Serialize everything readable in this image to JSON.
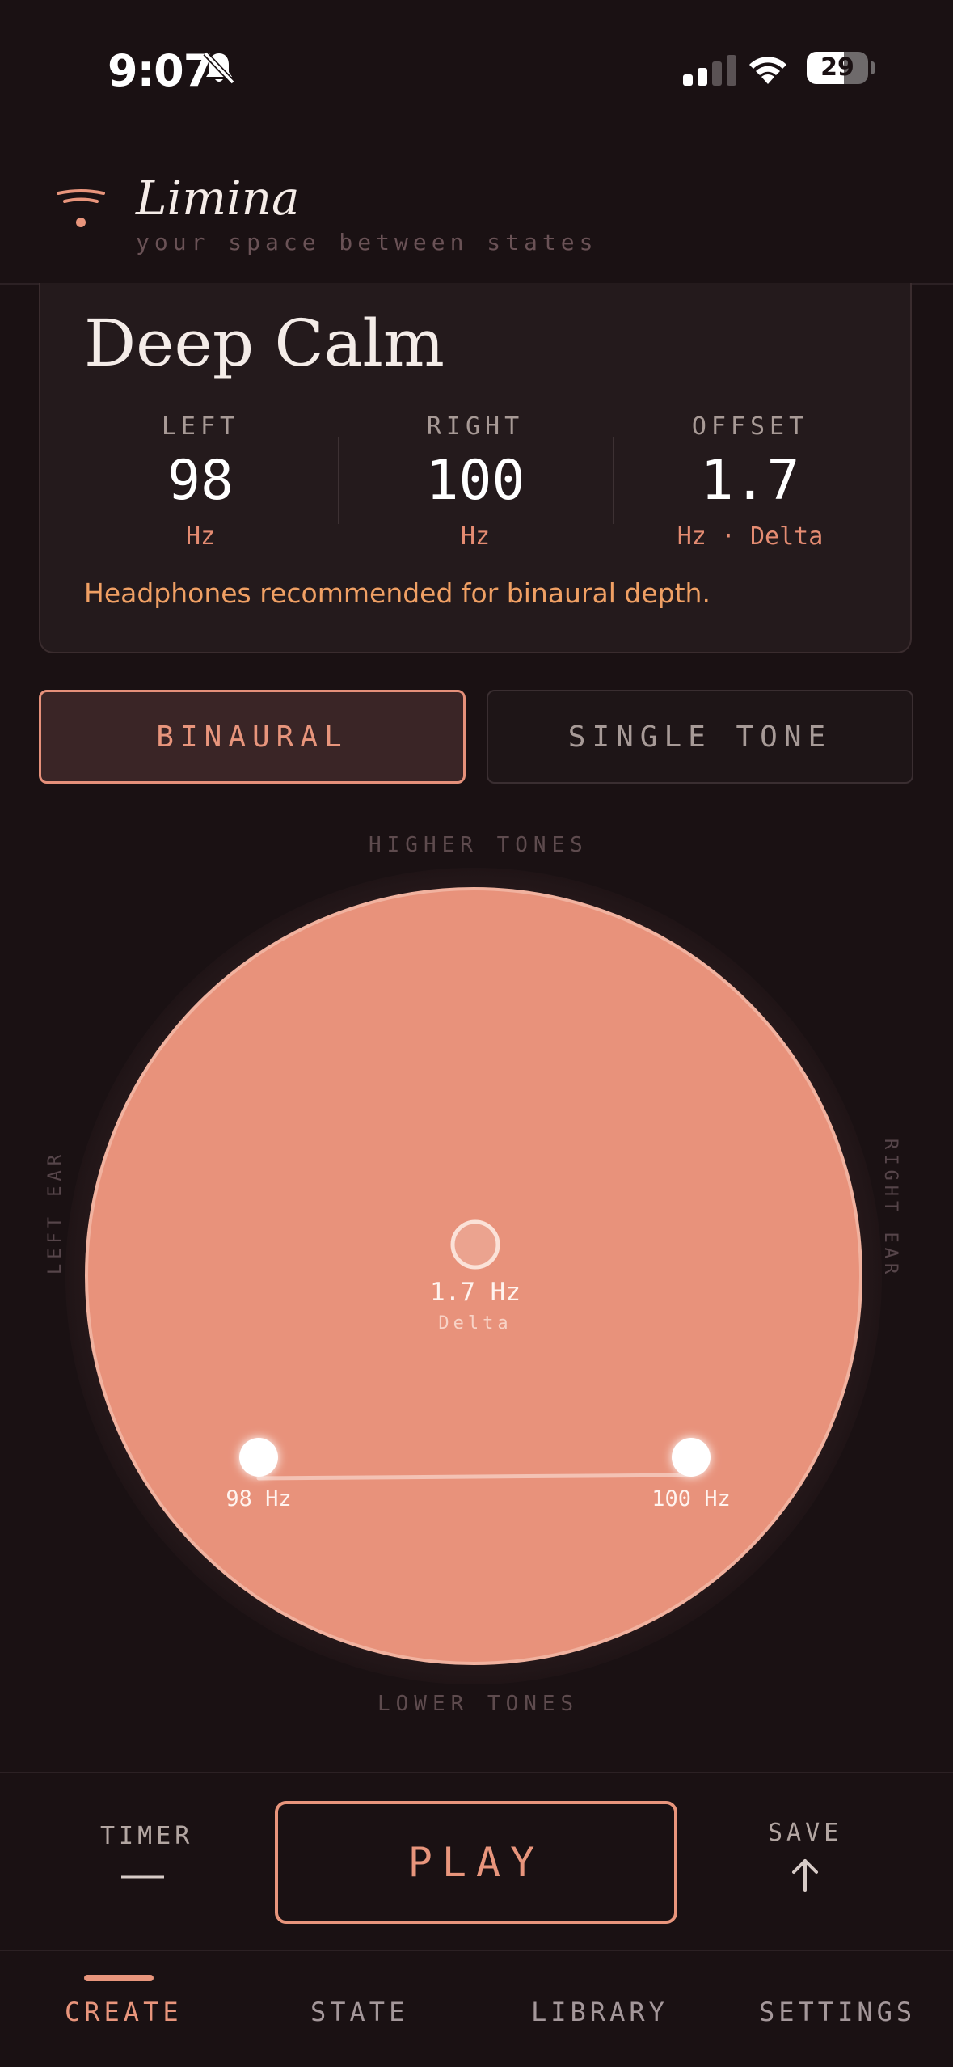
{
  "status_bar": {
    "time": "9:07",
    "battery": "29"
  },
  "header": {
    "brand": "Limina",
    "tagline": "your space between states"
  },
  "preset": {
    "name": "Deep Calm",
    "left": {
      "label": "LEFT",
      "value": "98",
      "unit": "Hz"
    },
    "right": {
      "label": "RIGHT",
      "value": "100",
      "unit": "Hz"
    },
    "offset": {
      "label": "OFFSET",
      "value": "1.7",
      "unit": "Hz · Delta"
    },
    "note": "Headphones recommended for binaural depth."
  },
  "mode": {
    "binaural": "BINAURAL",
    "single": "SINGLE TONE",
    "selected": "binaural"
  },
  "dial": {
    "top_label": "HIGHER TONES",
    "bottom_label": "LOWER TONES",
    "left_label": "LEFT EAR",
    "right_label": "RIGHT EAR",
    "center_value": "1.7 Hz",
    "center_band": "Delta",
    "left_marker": "98 Hz",
    "right_marker": "100 Hz",
    "fill_color": "#e8927b"
  },
  "controls": {
    "timer_label": "TIMER",
    "timer_value": "——",
    "play": "PLAY",
    "save_label": "SAVE"
  },
  "nav": {
    "items": [
      {
        "label": "CREATE",
        "active": true
      },
      {
        "label": "STATE",
        "active": false
      },
      {
        "label": "LIBRARY",
        "active": false
      },
      {
        "label": "SETTINGS",
        "active": false
      }
    ]
  },
  "colors": {
    "accent": "#e8957c",
    "background": "#1a1113",
    "note": "#f0a064"
  }
}
